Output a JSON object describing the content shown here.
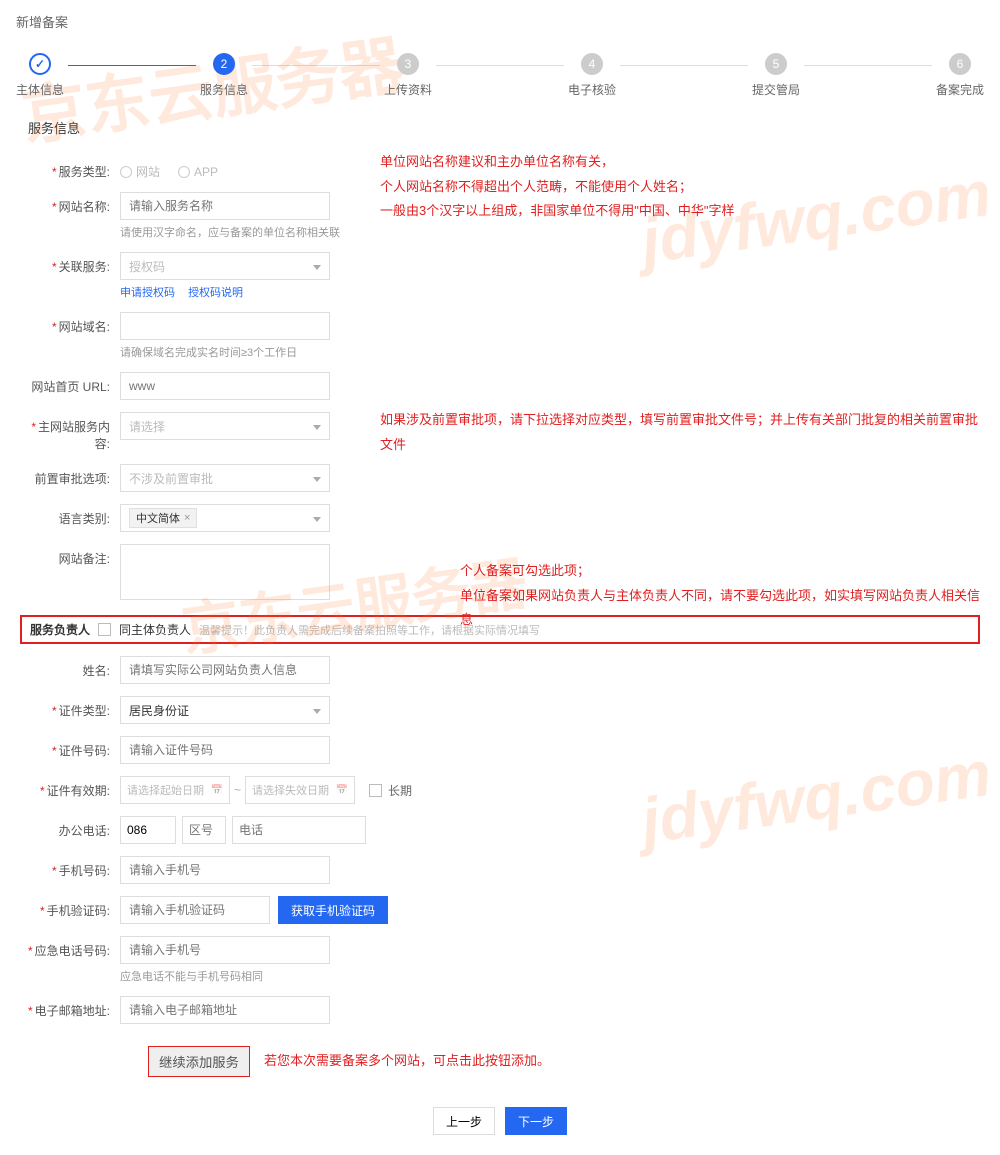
{
  "page_title": "新增备案",
  "steps": [
    {
      "label": "主体信息",
      "state": "done"
    },
    {
      "label": "服务信息",
      "state": "active",
      "num": "2"
    },
    {
      "label": "上传资料",
      "state": "pending",
      "num": "3"
    },
    {
      "label": "电子核验",
      "state": "pending",
      "num": "4"
    },
    {
      "label": "提交管局",
      "state": "pending",
      "num": "5"
    },
    {
      "label": "备案完成",
      "state": "pending",
      "num": "6"
    }
  ],
  "section_title": "服务信息",
  "form": {
    "service_type": {
      "label": "服务类型:",
      "options": [
        "网站",
        "APP"
      ]
    },
    "site_name": {
      "label": "网站名称:",
      "placeholder": "请输入服务名称",
      "hint": "请使用汉字命名，应与备案的单位名称相关联"
    },
    "related_service": {
      "label": "关联服务:",
      "selected": "授权码",
      "links": [
        "申请授权码",
        "授权码说明"
      ]
    },
    "domain": {
      "label": "网站域名:",
      "hint": "请确保域名完成实名时间≥3个工作日"
    },
    "home_url": {
      "label": "网站首页 URL:",
      "placeholder": "www"
    },
    "main_content": {
      "label": "主网站服务内容:",
      "placeholder": "请选择"
    },
    "pre_approval": {
      "label": "前置审批选项:",
      "placeholder": "不涉及前置审批"
    },
    "language": {
      "label": "语言类别:",
      "selected": "中文简体"
    },
    "remark": {
      "label": "网站备注:"
    }
  },
  "notes": {
    "name_note": [
      "单位网站名称建议和主办单位名称有关，",
      "个人网站名称不得超出个人范畴，不能使用个人姓名；",
      "一般由3个汉字以上组成，非国家单位不得用\"中国、中华\"字样"
    ],
    "approval_note": "如果涉及前置审批项，请下拉选择对应类型，填写前置审批文件号；并上传有关部门批复的相关前置审批文件",
    "responsible_note": [
      "个人备案可勾选此项；",
      "单位备案如果网站负责人与主体负责人不同，请不要勾选此项，如实填写网站负责人相关信息"
    ],
    "add_note": "若您本次需要备案多个网站，可点击此按钮添加。"
  },
  "responsible": {
    "title": "服务负责人",
    "checkbox_label": "同主体负责人",
    "warn": "温馨提示！此负责人需完成后续备案拍照等工作，请根据实际情况填写",
    "name": {
      "label": "姓名:",
      "placeholder": "请填写实际公司网站负责人信息"
    },
    "id_type": {
      "label": "证件类型:",
      "selected": "居民身份证"
    },
    "id_number": {
      "label": "证件号码:",
      "placeholder": "请输入证件号码"
    },
    "id_valid": {
      "label": "证件有效期:",
      "start_placeholder": "请选择起始日期",
      "end_placeholder": "请选择失效日期",
      "long_term": "长期"
    },
    "office_phone": {
      "label": "办公电话:",
      "country": "086",
      "area_placeholder": "区号",
      "num_placeholder": "电话"
    },
    "mobile": {
      "label": "手机号码:",
      "placeholder": "请输入手机号"
    },
    "verify": {
      "label": "手机验证码:",
      "placeholder": "请输入手机验证码",
      "btn": "获取手机验证码"
    },
    "emergency": {
      "label": "应急电话号码:",
      "placeholder": "请输入手机号",
      "hint": "应急电话不能与手机号码相同"
    },
    "email": {
      "label": "电子邮箱地址:",
      "placeholder": "请输入电子邮箱地址"
    }
  },
  "add_btn": "继续添加服务",
  "footer": {
    "prev": "上一步",
    "next": "下一步"
  },
  "watermarks": {
    "cn": "京东云服务器",
    "en": "jdyfwq.com"
  }
}
